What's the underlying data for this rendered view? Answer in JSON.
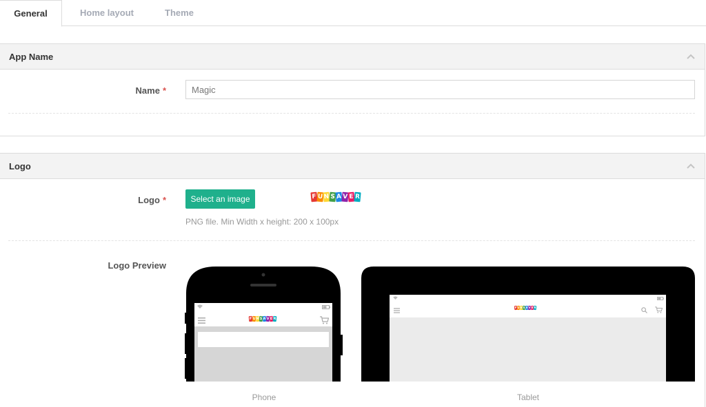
{
  "tabs": [
    {
      "label": "General",
      "active": true
    },
    {
      "label": "Home layout",
      "active": false
    },
    {
      "label": "Theme",
      "active": false
    }
  ],
  "app_name_panel": {
    "title": "App Name",
    "name_label": "Name",
    "required_mark": "*",
    "name_value": "Magic"
  },
  "logo_panel": {
    "title": "Logo",
    "logo_label": "Logo",
    "required_mark": "*",
    "select_button": "Select an image",
    "help_text": "PNG file. Min Width x height: 200 x 100px",
    "preview_label": "Logo Preview",
    "phone_caption": "Phone",
    "tablet_caption": "Tablet"
  },
  "logo": {
    "letters": [
      "F",
      "U",
      "N",
      "S",
      "A",
      "V",
      "E",
      "R"
    ],
    "colors": [
      "#e53935",
      "#fb8c00",
      "#fdd835",
      "#43a047",
      "#1e88e5",
      "#8e24aa",
      "#e91e63",
      "#00acc1"
    ]
  },
  "icons": [
    "chevron-up-icon",
    "wifi-icon",
    "battery-icon",
    "menu-icon",
    "cart-icon",
    "search-icon"
  ],
  "colors": {
    "accent": "#1fb08c",
    "required": "#d9534f",
    "device": "#000000"
  }
}
